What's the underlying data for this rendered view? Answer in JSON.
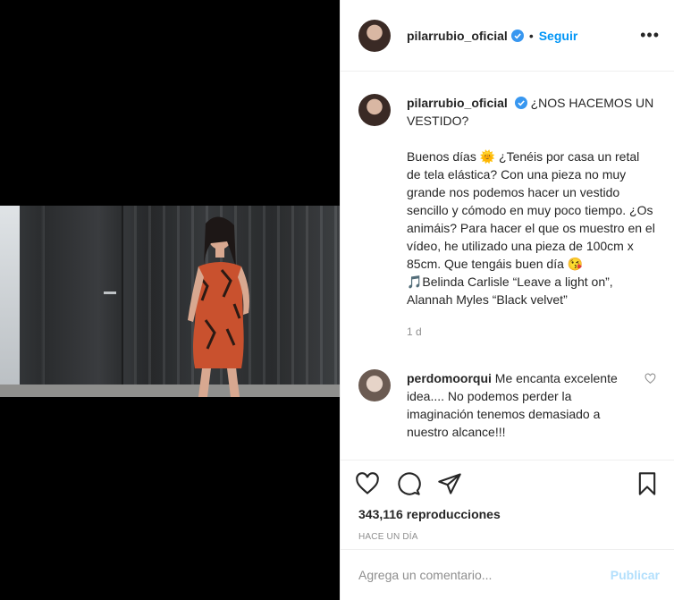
{
  "post": {
    "username": "pilarrubio_oficial",
    "follow_label": "Seguir",
    "dot": "•",
    "more_label": "•••"
  },
  "caption": {
    "author": "pilarrubio_oficial",
    "title": "¿NOS HACEMOS UN VESTIDO?",
    "body": "Buenos días 🌞 ¿Tenéis por casa un retal de tela elástica? Con una pieza no muy grande nos podemos hacer un vestido sencillo y cómodo en muy poco tiempo. ¿Os animáis? Para hacer el que os muestro en el vídeo, he utilizado una pieza de 100cm x 85cm. Que tengáis buen día 😘\n🎵Belinda Carlisle “Leave a light on”, Alannah Myles “Black velvet”",
    "time": "1 d"
  },
  "comment": {
    "author": "perdomoorqui",
    "text": "Me encanta excelente idea.... No podemos perder la imaginación tenemos demasiado a nuestro alcance!!!"
  },
  "stats": {
    "views": "343,116 reproducciones",
    "ago": "HACE UN DÍA"
  },
  "composer": {
    "placeholder": "Agrega un comentario...",
    "post_label": "Publicar"
  },
  "colors": {
    "accent": "#0095f6",
    "post_disabled": "#b2dffc",
    "muted": "#8e8e8e",
    "dress": "#c9512e"
  }
}
